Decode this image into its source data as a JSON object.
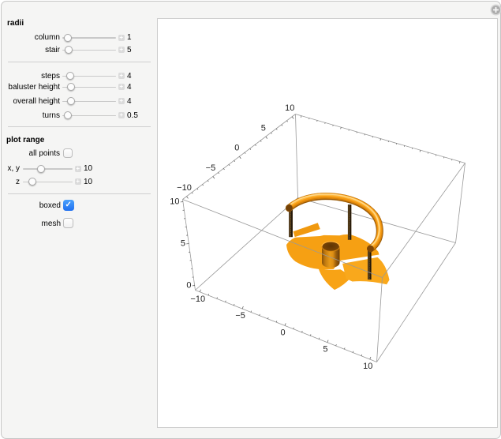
{
  "window": {
    "expand_button_icon": "plus-circle-icon"
  },
  "controls": {
    "radii_header": "radii",
    "plot_range_header": "plot range",
    "sliders": [
      {
        "label": "column",
        "value": "1"
      },
      {
        "label": "stair",
        "value": "5"
      },
      {
        "label": "steps",
        "value": "4"
      },
      {
        "label": "baluster height",
        "value": "4"
      },
      {
        "label": "overall height",
        "value": "4"
      },
      {
        "label": "turns",
        "value": "0.5"
      },
      {
        "label": "x, y",
        "value": "10"
      },
      {
        "label": "z",
        "value": "10"
      }
    ],
    "checkboxes": [
      {
        "label": "all points",
        "checked": false
      },
      {
        "label": "boxed",
        "checked": true
      },
      {
        "label": "mesh",
        "checked": false
      }
    ],
    "check_glyph": "✓",
    "stepper_glyph": "+"
  },
  "chart_data": {
    "type": "3d-plot",
    "title": "",
    "description": "Boxed 3D rendering of a spiral staircase: central column, 4 fanned sector steps, 3 balusters and a helical handrail",
    "parameters": {
      "column_radius": 1,
      "stair_radius": 5,
      "steps": 4,
      "baluster_height": 4,
      "overall_height": 4,
      "turns": 0.5,
      "plot_range_xy": 10,
      "plot_range_z": 10,
      "boxed": true,
      "mesh": false
    },
    "axes": {
      "x": {
        "range": [
          -10,
          10
        ],
        "minor_step": 1,
        "tick_values": [
          -10,
          -5,
          0,
          5,
          10
        ],
        "tick_labels": [
          "−10",
          "−5",
          "0",
          "5",
          "10"
        ]
      },
      "y": {
        "range": [
          -10,
          10
        ],
        "minor_step": 1,
        "tick_values": [
          -10,
          -5,
          0,
          5,
          10
        ],
        "tick_labels": [
          "−10",
          "−5",
          "0",
          "5",
          "10"
        ]
      },
      "z": {
        "range": [
          0,
          10
        ],
        "minor_step": 1,
        "tick_values": [
          0,
          5,
          10
        ],
        "tick_labels": [
          "0",
          "5",
          "10"
        ]
      }
    },
    "colors": {
      "stair_orange": "#F6A013",
      "rail_highlight": "#FFD98C",
      "rail_dark": "#9A5A06",
      "baluster_dark": "#3C2B12",
      "box_lines": "#999999"
    }
  }
}
